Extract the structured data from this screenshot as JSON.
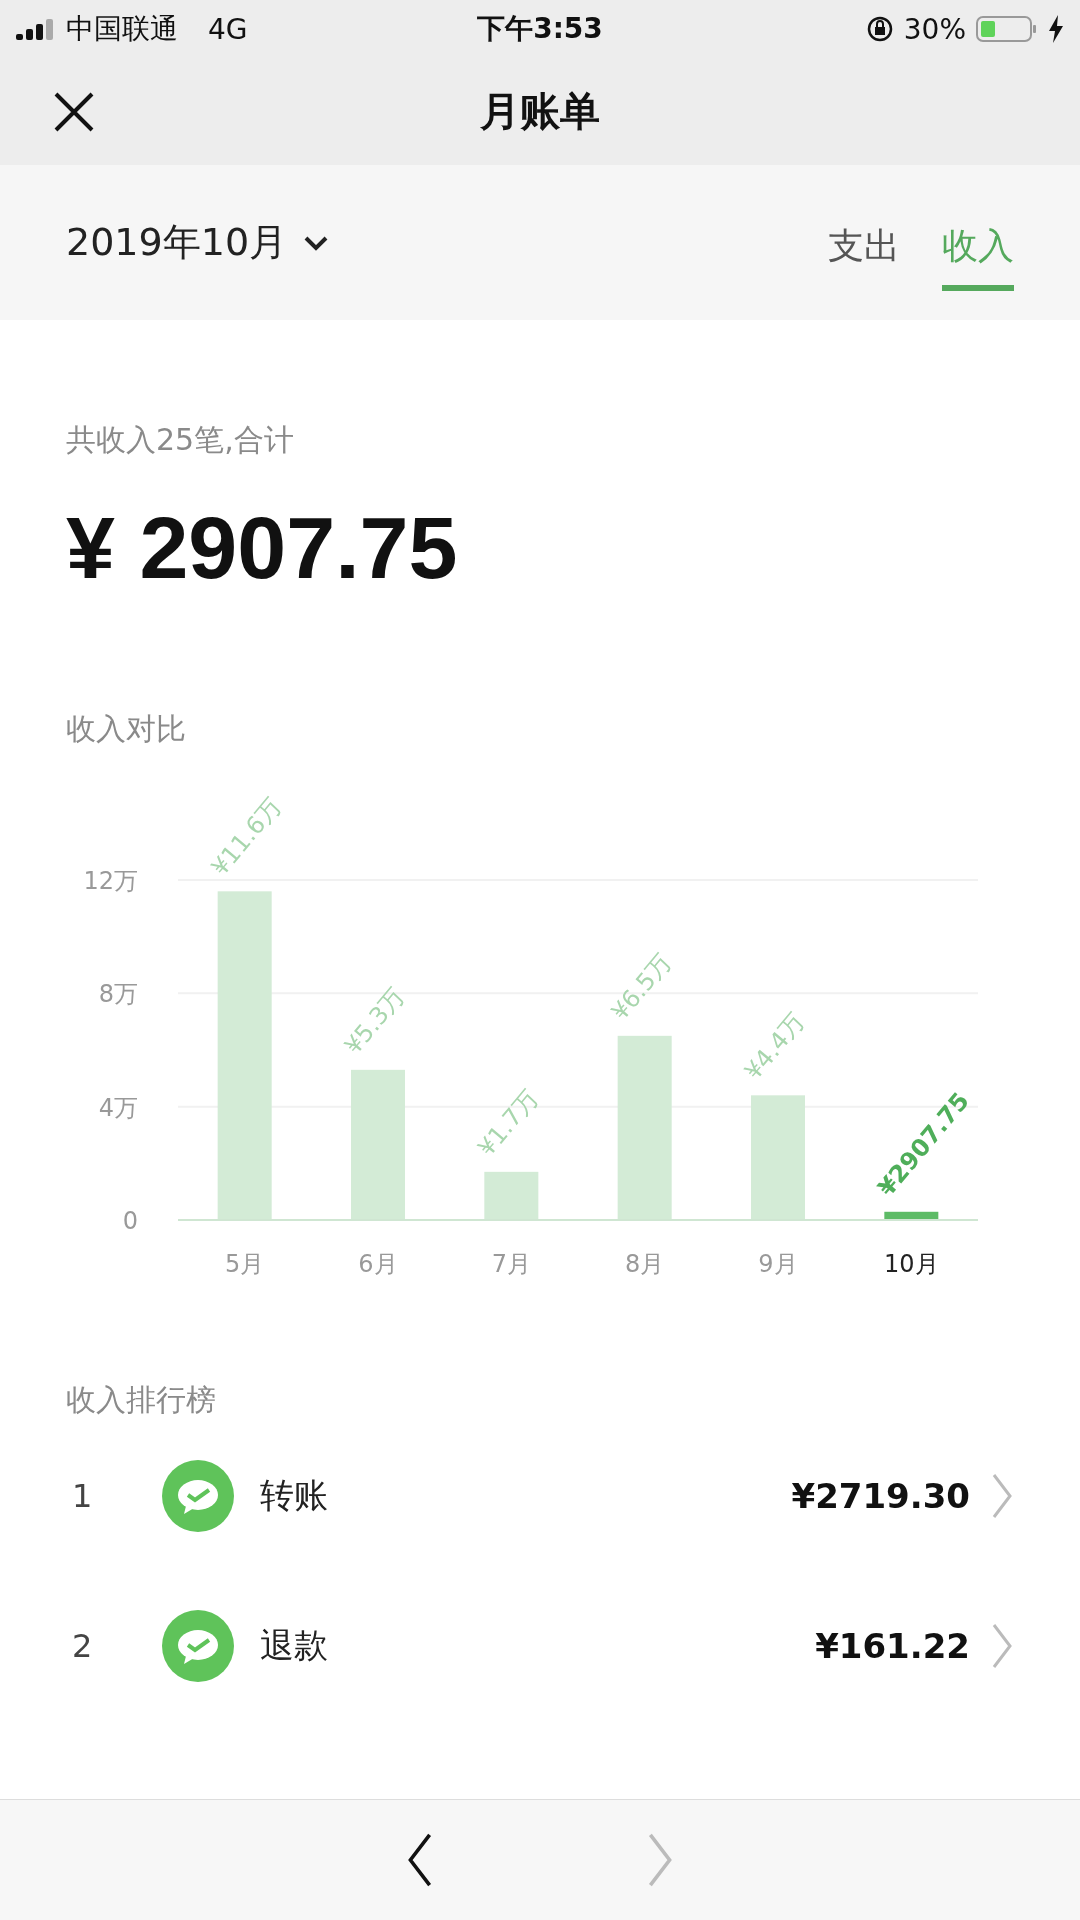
{
  "status_bar": {
    "carrier": "中国联通",
    "network": "4G",
    "time": "下午3:53",
    "battery": "30%"
  },
  "nav": {
    "title": "月账单"
  },
  "header": {
    "month": "2019年10月",
    "tabs": [
      {
        "label": "支出",
        "selected": false
      },
      {
        "label": "收入",
        "selected": true
      }
    ]
  },
  "summary": {
    "caption": "共收入25笔,合计",
    "amount": "¥ 2907.75"
  },
  "chart": {
    "title": "收入对比",
    "chart_data": {
      "type": "bar",
      "categories": [
        "5月",
        "6月",
        "7月",
        "8月",
        "9月",
        "10月"
      ],
      "series": [
        {
          "color": "#d3ebd6",
          "values": [
            11.6,
            5.3,
            1.7,
            6.5,
            4.4,
            null
          ]
        },
        {
          "color": "#5dbb66",
          "values": [
            null,
            null,
            null,
            null,
            null,
            0.29
          ]
        }
      ],
      "stacked": true,
      "ylim": [
        0,
        12
      ],
      "yticks": [
        {
          "value": 0,
          "label": "0"
        },
        {
          "value": 4,
          "label": "4万"
        },
        {
          "value": 8,
          "label": "8万"
        },
        {
          "value": 12,
          "label": "12万"
        }
      ],
      "value_labels": [
        "¥11.6万",
        "¥5.3万",
        "¥1.7万",
        "¥6.5万",
        "¥4.4万",
        "¥2907.75"
      ]
    }
  },
  "ranking": {
    "title": "收入排行榜",
    "items": [
      {
        "rank": "1",
        "name": "转账",
        "amount": "¥2719.30"
      },
      {
        "rank": "2",
        "name": "退款",
        "amount": "¥161.22"
      }
    ]
  },
  "bottom_bar": {
    "buttons": [
      {
        "kind": "back",
        "disabled": false
      },
      {
        "kind": "forward",
        "disabled": true
      }
    ]
  }
}
